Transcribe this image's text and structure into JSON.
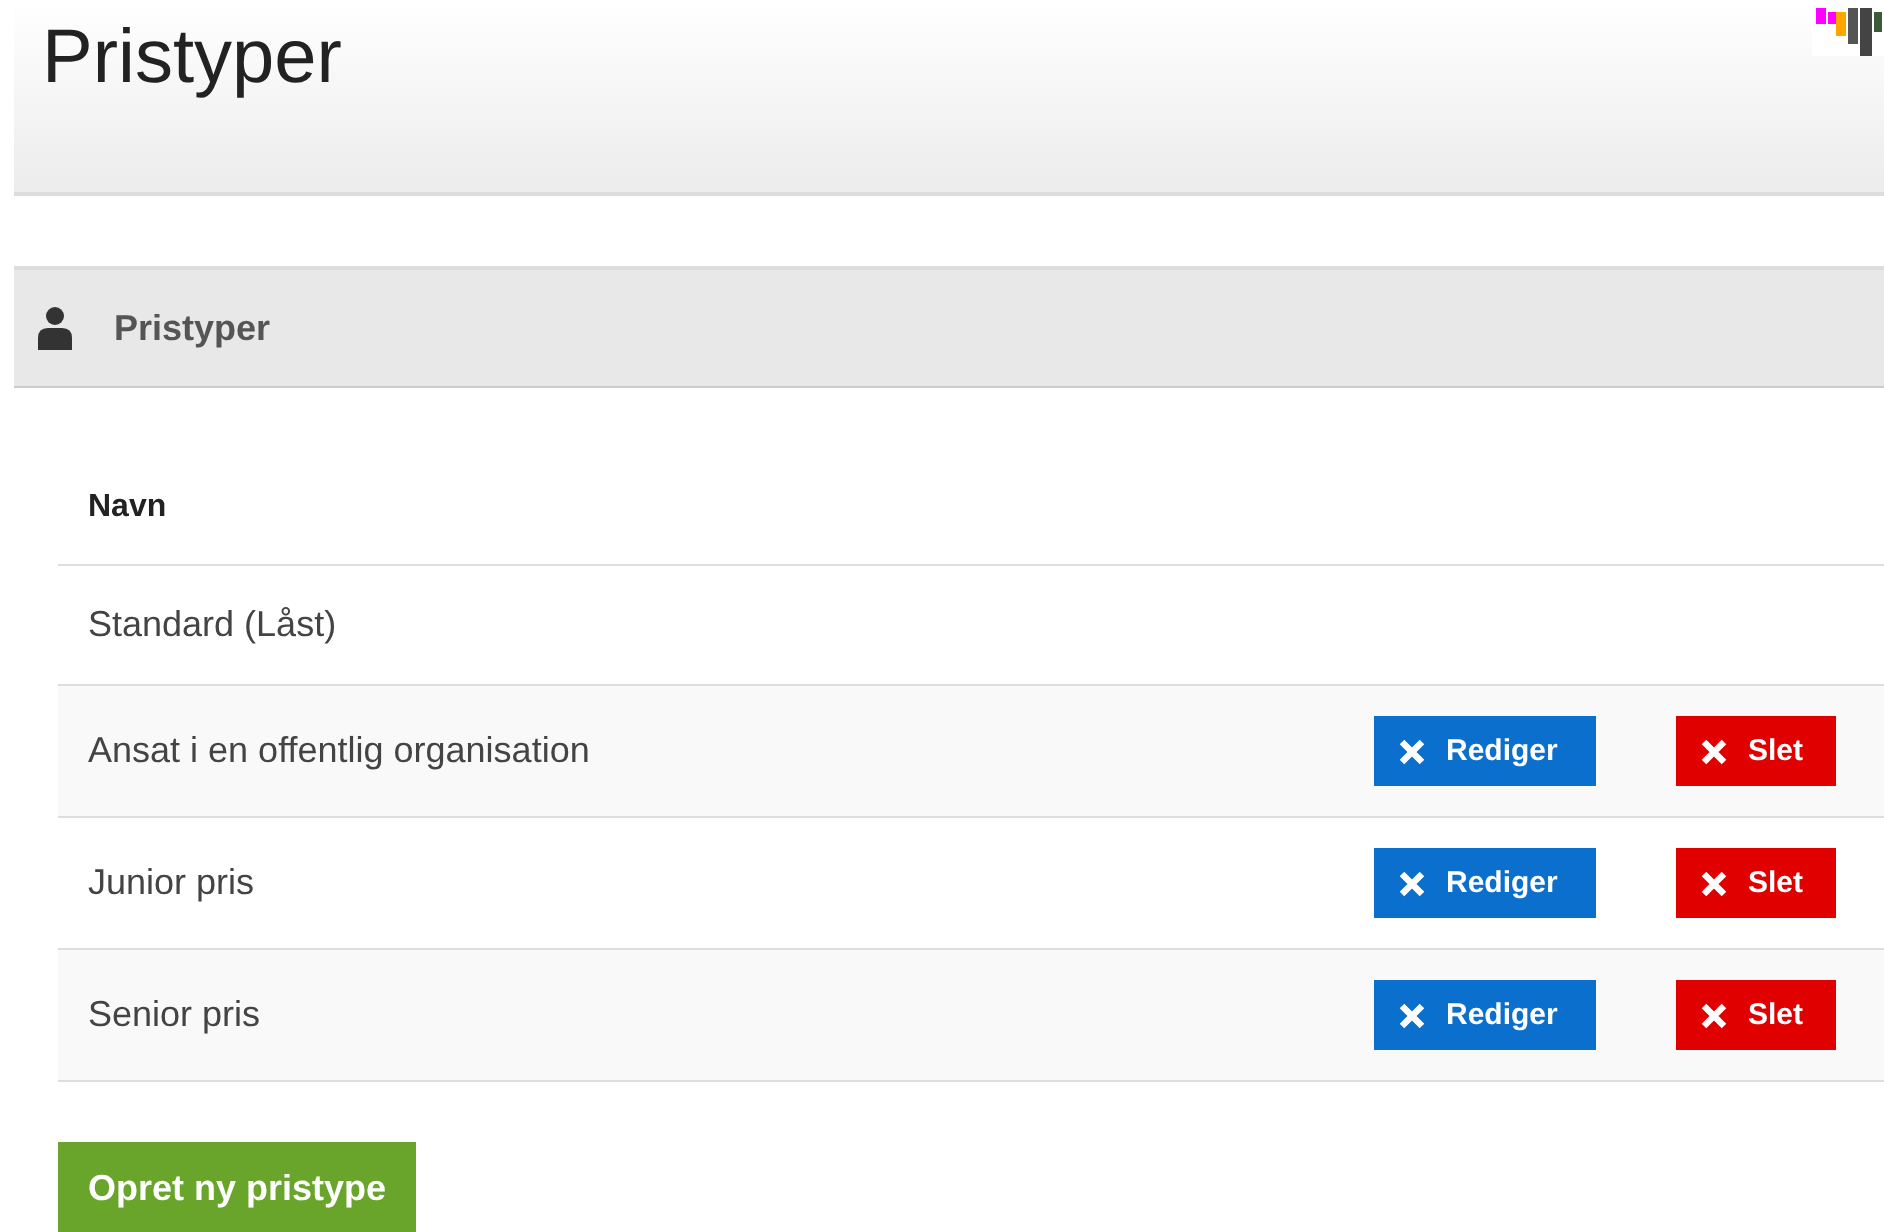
{
  "page_title": "Pristyper",
  "panel": {
    "title": "Pristyper"
  },
  "table": {
    "columns": [
      "Navn"
    ],
    "rows": [
      {
        "name": "Standard (Låst)"
      },
      {
        "name": "Ansat i en offentlig organisation",
        "actions": [
          {
            "kind": "edit",
            "label": "Rediger"
          },
          {
            "kind": "delete",
            "label": "Slet"
          }
        ]
      },
      {
        "name": "Junior pris",
        "actions": [
          {
            "kind": "edit",
            "label": "Rediger"
          },
          {
            "kind": "delete",
            "label": "Slet"
          }
        ]
      },
      {
        "name": "Senior pris",
        "actions": [
          {
            "kind": "edit",
            "label": "Rediger"
          },
          {
            "kind": "delete",
            "label": "Slet"
          }
        ]
      }
    ]
  },
  "create_button": "Opret ny pristype"
}
